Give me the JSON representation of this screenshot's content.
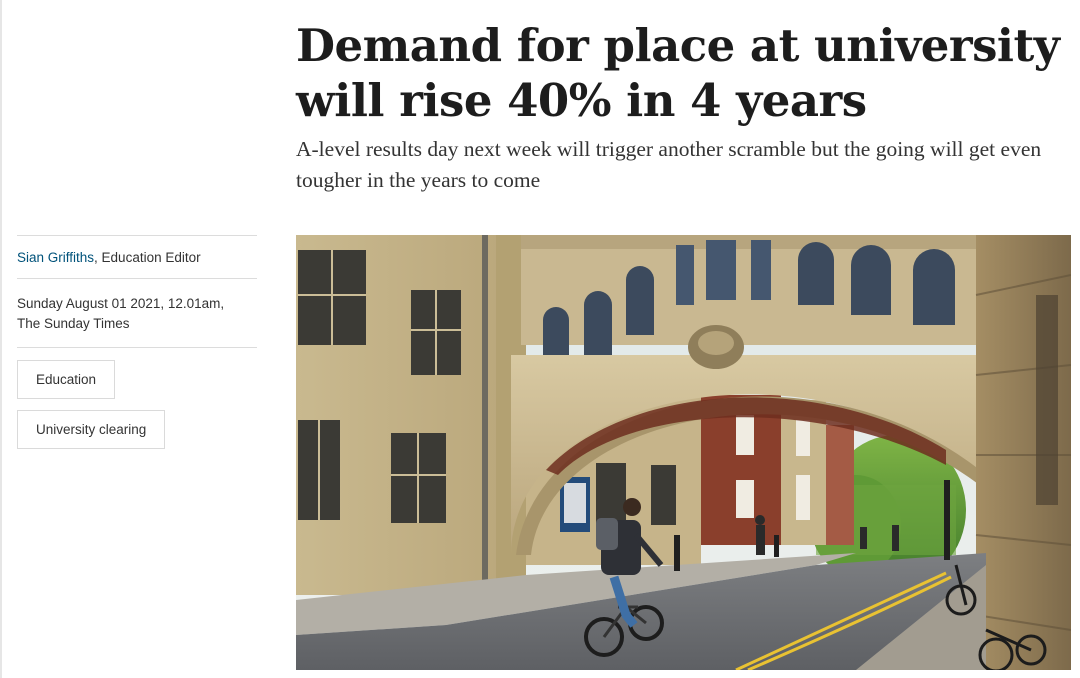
{
  "article": {
    "headline": "Demand for place at university will rise 40% in 4 years",
    "standfirst": "A-level results day next week will trigger another scramble but the going will get even tougher in the years to come",
    "author": "Sian Griffiths",
    "author_role": ", Education Editor",
    "date": "Sunday August 01 2021, 12.01am,",
    "publication": "The Sunday Times",
    "tags": [
      "Education",
      "University clearing"
    ],
    "image_subject": "bridge-of-sighs-oxford-photo"
  }
}
